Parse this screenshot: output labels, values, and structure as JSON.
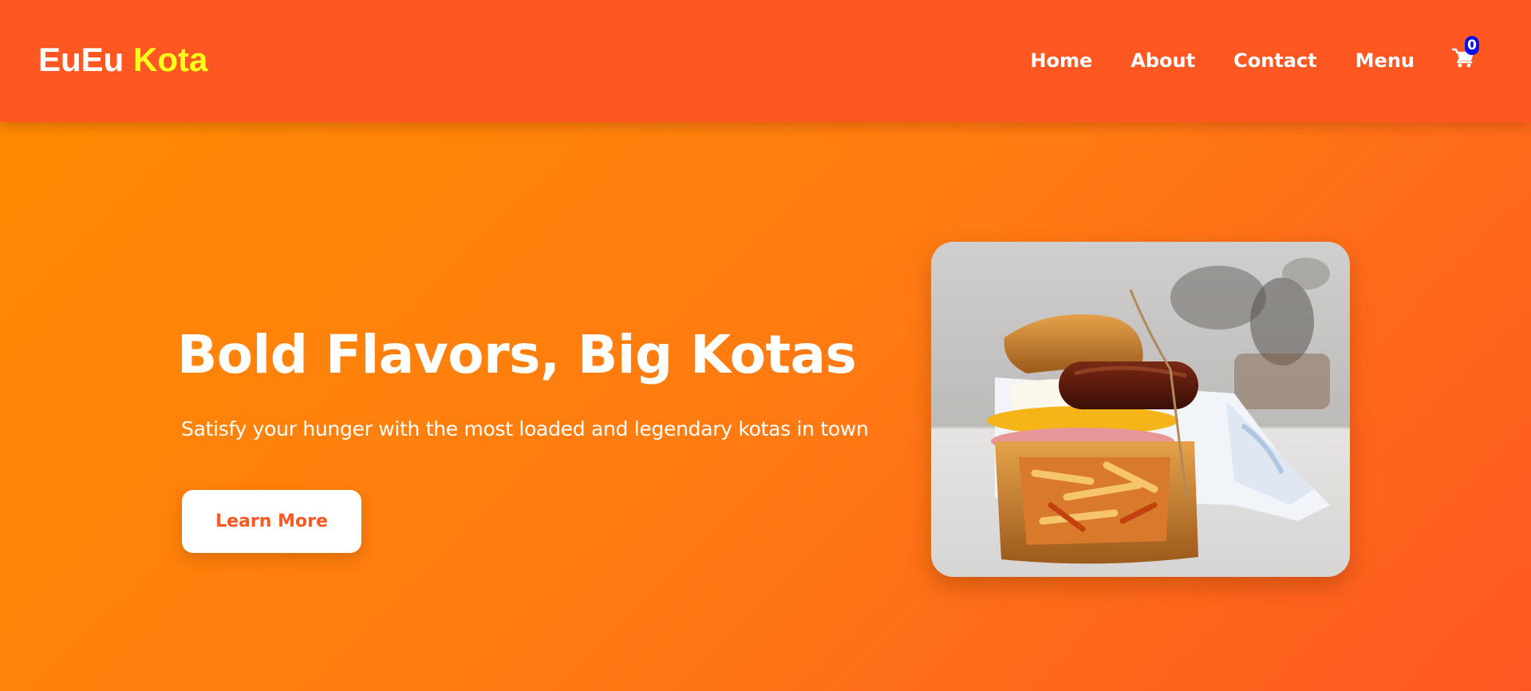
{
  "brand": {
    "name_primary": "EuEu",
    "name_accent": "Kota",
    "primary_color": "#ff5722",
    "accent_text_color": "#ffff1a",
    "hero_gradient": [
      "#ff8c00",
      "#ff5722"
    ]
  },
  "nav": {
    "links": [
      {
        "label": "Home"
      },
      {
        "label": "About"
      },
      {
        "label": "Contact"
      },
      {
        "label": "Menu"
      }
    ],
    "cart": {
      "icon": "shopping-cart-icon",
      "count": "0",
      "badge_color": "#0a10e8"
    }
  },
  "hero": {
    "title": "Bold Flavors, Big Kotas",
    "subtitle": "Satisfy your hunger with the most loaded and legendary kotas in town",
    "cta_label": "Learn More",
    "image": {
      "description": "loaded kota sandwich with sausage, egg, polony and fries wrapped in paper"
    }
  }
}
